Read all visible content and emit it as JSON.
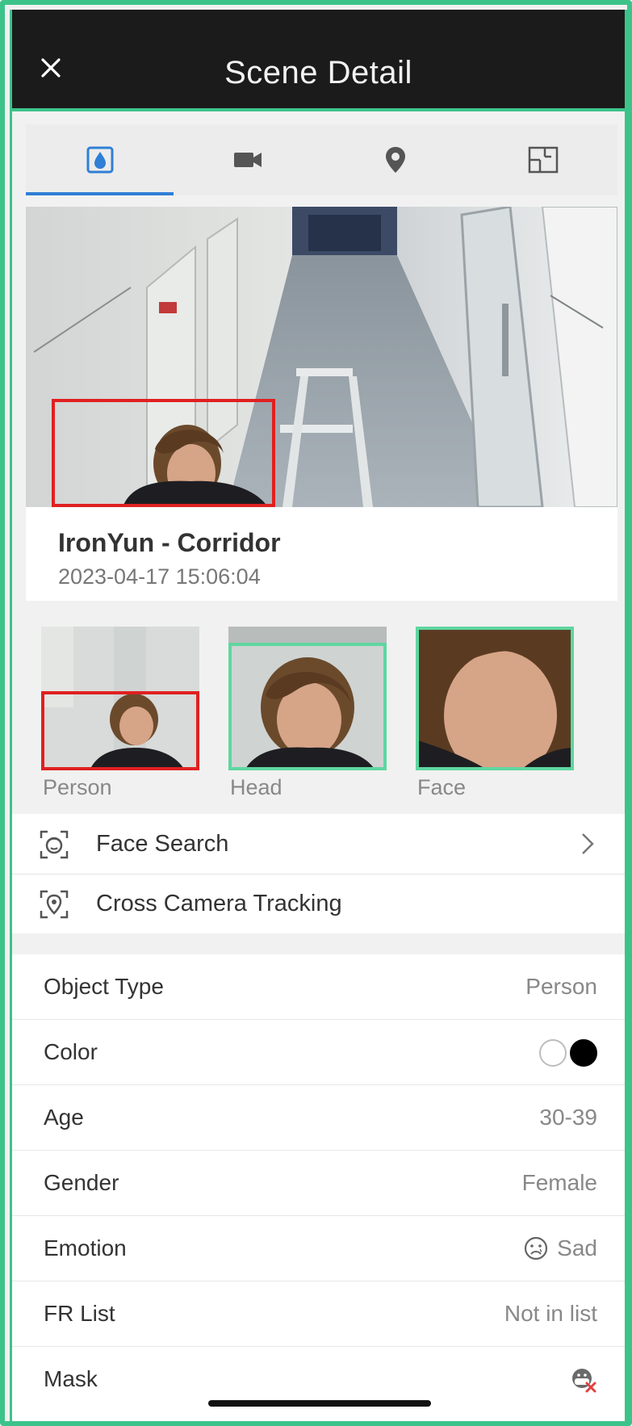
{
  "header": {
    "title": "Scene Detail"
  },
  "tabs": [
    {
      "icon": "water-drop-icon",
      "active": true
    },
    {
      "icon": "video-camera-icon",
      "active": false
    },
    {
      "icon": "location-pin-icon",
      "active": false
    },
    {
      "icon": "floor-plan-icon",
      "active": false
    }
  ],
  "scene": {
    "camera_name": "IronYun - Corridor",
    "timestamp": "2023-04-17 15:06:04"
  },
  "crops": [
    {
      "label": "Person",
      "box_color": "#e02020"
    },
    {
      "label": "Head",
      "box_color": "#5fd6a0"
    },
    {
      "label": "Face",
      "box_color": "#5fd6a0"
    }
  ],
  "actions": [
    {
      "label": "Face Search",
      "icon": "face-scan-icon"
    },
    {
      "label": "Cross Camera Tracking",
      "icon": "location-scan-icon"
    }
  ],
  "attributes": {
    "object_type": {
      "label": "Object Type",
      "value": "Person"
    },
    "color": {
      "label": "Color",
      "swatches": [
        "#ffffff",
        "#000000"
      ]
    },
    "age": {
      "label": "Age",
      "value": "30-39"
    },
    "gender": {
      "label": "Gender",
      "value": "Female"
    },
    "emotion": {
      "label": "Emotion",
      "value": "Sad",
      "icon": "sad-face-icon"
    },
    "fr_list": {
      "label": "FR List",
      "value": "Not in list"
    },
    "mask": {
      "label": "Mask",
      "icon": "no-mask-icon"
    }
  },
  "colors": {
    "accent": "#2f7fd6",
    "frame": "#3cc38a",
    "header": "#1b1b1b",
    "detection_red": "#e02020"
  }
}
